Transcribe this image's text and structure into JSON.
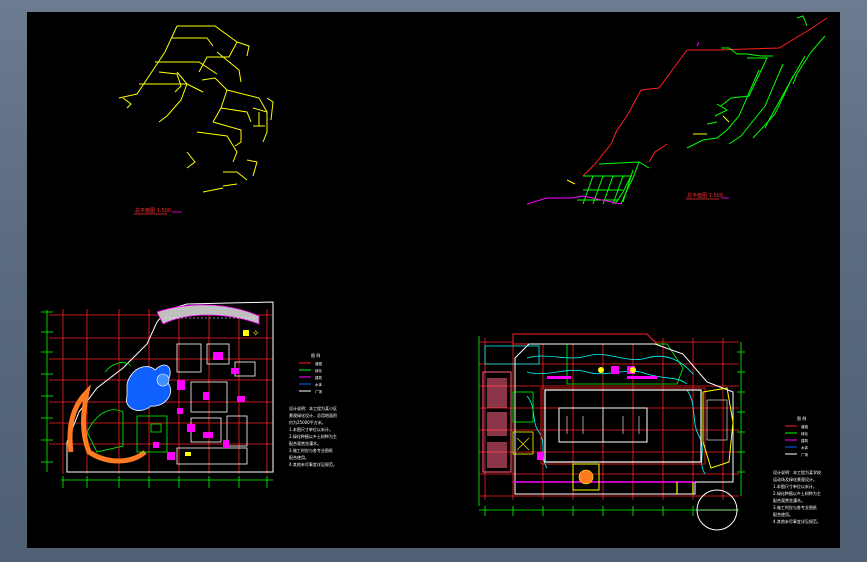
{
  "drawing": {
    "view_labels": {
      "left_perspective": "总平面图 1:500",
      "right_perspective": "总平面图 1:500"
    },
    "legend_left": {
      "title": "图 例",
      "items": [
        "道路",
        "绿化",
        "建筑",
        "水体",
        "广场"
      ]
    },
    "legend_right": {
      "title": "图 例",
      "items": [
        "道路",
        "绿化",
        "建筑",
        "水体",
        "广场"
      ]
    },
    "notes_left": [
      "设计说明：本工程为某小区",
      "景观绿化设计，总用地面积",
      "约为25000平方米。",
      "1.本图尺寸单位以米计。",
      "2.绿化种植以乡土树种为主",
      "配合观赏花灌木。",
      "3.施工时应与各专业图纸",
      "配合使用。",
      "4.其他未尽事宜详见规范。"
    ],
    "notes_right": [
      "设计说明：本工程为某学校",
      "运动场及绿化景观设计。",
      "1.本图尺寸单位以米计。",
      "2.绿化种植以乡土树种为主",
      "配合观赏花灌木。",
      "3.施工时应与各专业图纸",
      "配合使用。",
      "4.其他未尽事宜详见规范。"
    ],
    "colors": {
      "background": "#000000",
      "frame": "#5f6f83",
      "grid_red": "#ff2020",
      "green": "#00ff00",
      "yellow": "#ffff00",
      "magenta": "#ff00ff",
      "cyan": "#00ffff",
      "blue": "#1060ff",
      "orange": "#ff7a20",
      "white": "#ffffff"
    }
  }
}
